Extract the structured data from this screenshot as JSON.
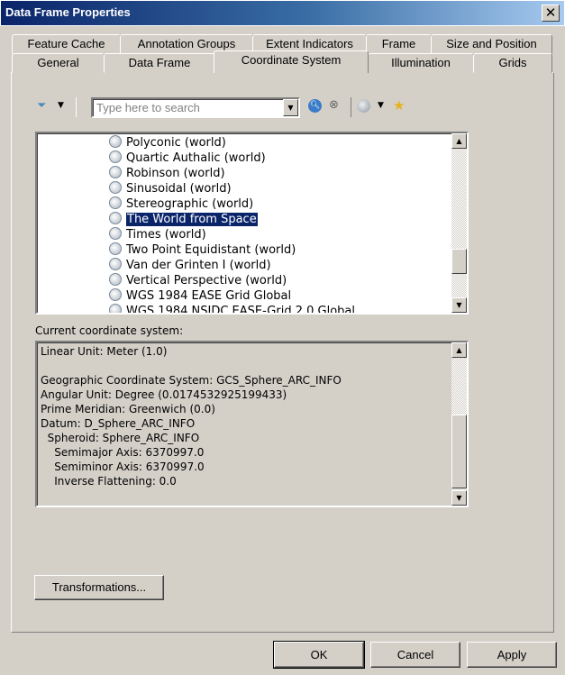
{
  "window": {
    "title": "Data Frame Properties",
    "close": "✕"
  },
  "tabs_row1": [
    {
      "label": "Feature Cache"
    },
    {
      "label": "Annotation Groups"
    },
    {
      "label": "Extent Indicators"
    },
    {
      "label": "Frame"
    },
    {
      "label": "Size and Position"
    }
  ],
  "tabs_row2": [
    {
      "label": "General"
    },
    {
      "label": "Data Frame"
    },
    {
      "label": "Coordinate System",
      "selected": true
    },
    {
      "label": "Illumination"
    },
    {
      "label": "Grids"
    }
  ],
  "toolbar": {
    "search_placeholder": "Type here to search",
    "search_value": "",
    "icons": [
      "filter-icon",
      "search-icon",
      "clear-search-icon",
      "globe-add-icon",
      "favorite-add-icon"
    ]
  },
  "list": {
    "items": [
      "Polyconic (world)",
      "Quartic Authalic (world)",
      "Robinson (world)",
      "Sinusoidal (world)",
      "Stereographic (world)",
      "The World from Space",
      "Times (world)",
      "Two Point Equidistant (world)",
      "Van der Grinten I (world)",
      "Vertical Perspective (world)",
      "WGS 1984 EASE Grid Global",
      "WGS 1984 NSIDC EASE-Grid 2.0 Global"
    ],
    "selected": "The World from Space"
  },
  "current": {
    "label": "Current coordinate system:",
    "lines": [
      "Linear Unit: Meter (1.0)",
      "",
      "Geographic Coordinate System: GCS_Sphere_ARC_INFO",
      "Angular Unit: Degree (0.0174532925199433)",
      "Prime Meridian: Greenwich (0.0)",
      "Datum: D_Sphere_ARC_INFO",
      "  Spheroid: Sphere_ARC_INFO",
      "    Semimajor Axis: 6370997.0",
      "    Semiminor Axis: 6370997.0",
      "    Inverse Flattening: 0.0"
    ]
  },
  "buttons": {
    "transformations": "Transformations...",
    "ok": "OK",
    "cancel": "Cancel",
    "apply": "Apply"
  }
}
